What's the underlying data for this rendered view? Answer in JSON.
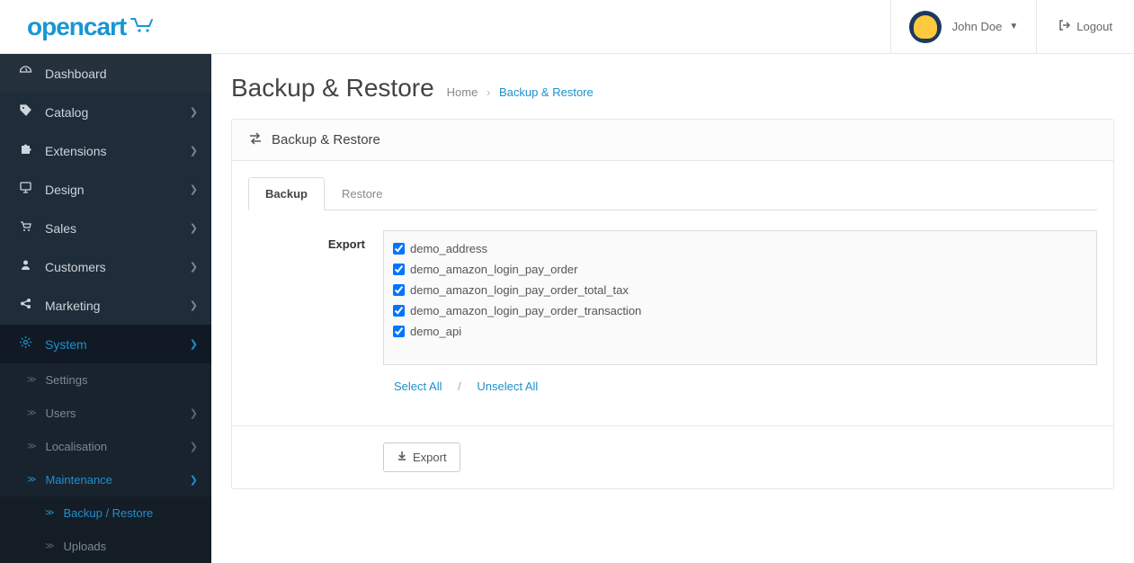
{
  "header": {
    "logo_text": "opencart",
    "user_name": "John Doe",
    "logout_label": "Logout"
  },
  "sidebar": {
    "items": [
      {
        "icon": "dashboard",
        "label": "Dashboard",
        "has_children": false
      },
      {
        "icon": "tag",
        "label": "Catalog",
        "has_children": true
      },
      {
        "icon": "puzzle",
        "label": "Extensions",
        "has_children": true
      },
      {
        "icon": "desktop",
        "label": "Design",
        "has_children": true
      },
      {
        "icon": "cart",
        "label": "Sales",
        "has_children": true
      },
      {
        "icon": "user",
        "label": "Customers",
        "has_children": true
      },
      {
        "icon": "share",
        "label": "Marketing",
        "has_children": true
      },
      {
        "icon": "gear",
        "label": "System",
        "has_children": true,
        "active": true
      }
    ],
    "system_sub": [
      {
        "label": "Settings",
        "has_children": false
      },
      {
        "label": "Users",
        "has_children": true
      },
      {
        "label": "Localisation",
        "has_children": true
      },
      {
        "label": "Maintenance",
        "has_children": true,
        "active": true
      }
    ],
    "maintenance_sub": [
      {
        "label": "Backup / Restore",
        "active": true
      },
      {
        "label": "Uploads",
        "active": false
      }
    ]
  },
  "page": {
    "title": "Backup & Restore",
    "breadcrumb_home": "Home",
    "breadcrumb_current": "Backup & Restore"
  },
  "panel": {
    "title": "Backup & Restore",
    "tabs": {
      "backup": "Backup",
      "restore": "Restore"
    },
    "export_label": "Export",
    "tables": [
      "demo_address",
      "demo_amazon_login_pay_order",
      "demo_amazon_login_pay_order_total_tax",
      "demo_amazon_login_pay_order_transaction",
      "demo_api"
    ],
    "select_all": "Select All",
    "unselect_all": "Unselect All",
    "export_button": "Export"
  }
}
